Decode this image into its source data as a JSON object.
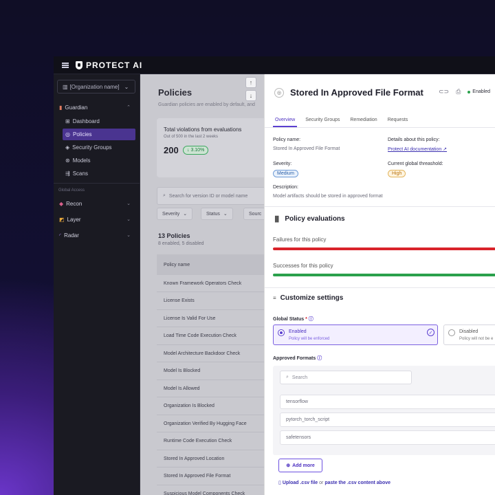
{
  "app": {
    "brand": "PROTECT AI"
  },
  "sidebar": {
    "org_selector": "[Organization name]",
    "guardian": {
      "label": "Guardian"
    },
    "items": [
      {
        "label": "Dashboard"
      },
      {
        "label": "Policies"
      },
      {
        "label": "Security Groups"
      },
      {
        "label": "Models"
      },
      {
        "label": "Scans"
      }
    ],
    "global_label": "Global Access",
    "global_items": [
      {
        "label": "Recon"
      },
      {
        "label": "Layer"
      },
      {
        "label": "Radar"
      }
    ]
  },
  "main": {
    "title": "Policies",
    "subtitle": "Guardian policies are enabled by default, and",
    "card": {
      "title": "Total violations from evaluations",
      "subtitle": "Out of 500 in the last 2 weeks",
      "value": "200",
      "change": "↓ 3.10%"
    },
    "search_placeholder": "Search for version ID or model name",
    "filters": [
      "Severity",
      "Status",
      "Sourc"
    ],
    "count_title": "13 Policies",
    "count_sub": "8 enabled, 5 disabled",
    "table_header": "Policy name",
    "rows": [
      "Known Framework Operators Check",
      "License Exists",
      "License Is Valid For Use",
      "Load Time Code Execution Check",
      "Model Architecture Backdoor Check",
      "Model Is Blocked",
      "Model Is Allowed",
      "Organization Is Blocked",
      "Organization Verified By Hugging Face",
      "Runtime Code Execution Check",
      "Stored In Approved Location",
      "Stored In Approved File Format",
      "Suspicious Model Components Check"
    ]
  },
  "panel": {
    "title": "Stored In Approved File Format",
    "status": "Enabled",
    "tabs": [
      "Overview",
      "Security Groups",
      "Remediation",
      "Requests"
    ],
    "policy_name_label": "Policy name:",
    "policy_name_value": "Stored In Approved File Format",
    "details_label": "Details about this policy:",
    "details_link": "Protect AI documentation",
    "severity_label": "Severity:",
    "severity_value": "Medium",
    "threshold_label": "Current global threashold:",
    "threshold_value": "High",
    "description_label": "Description:",
    "description_value": "Model artifacts should be stored in approved format",
    "evaluations_title": "Policy evaluations",
    "failures_label": "Failures for this policy",
    "successes_label": "Successes for this policy",
    "customize_title": "Customize settings",
    "global_status_label": "Global Status",
    "global_status_required": "*",
    "enabled_title": "Enabled",
    "enabled_sub": "Policy will be enforced",
    "disabled_title": "Disabled",
    "disabled_sub": "Policy will not be e",
    "formats_label": "Approved Formats",
    "formats_search": "Search",
    "formats": [
      "tensorflow",
      "pytorch_torch_script",
      "safetensors"
    ],
    "add_more": "Add more",
    "upload_link": "Upload .csv file",
    "upload_or": "or",
    "upload_paste": "paste the .csv content above"
  },
  "colors": {
    "accent": "#5b3fd0",
    "failure": "#d9232a",
    "success": "#2aa14c"
  }
}
